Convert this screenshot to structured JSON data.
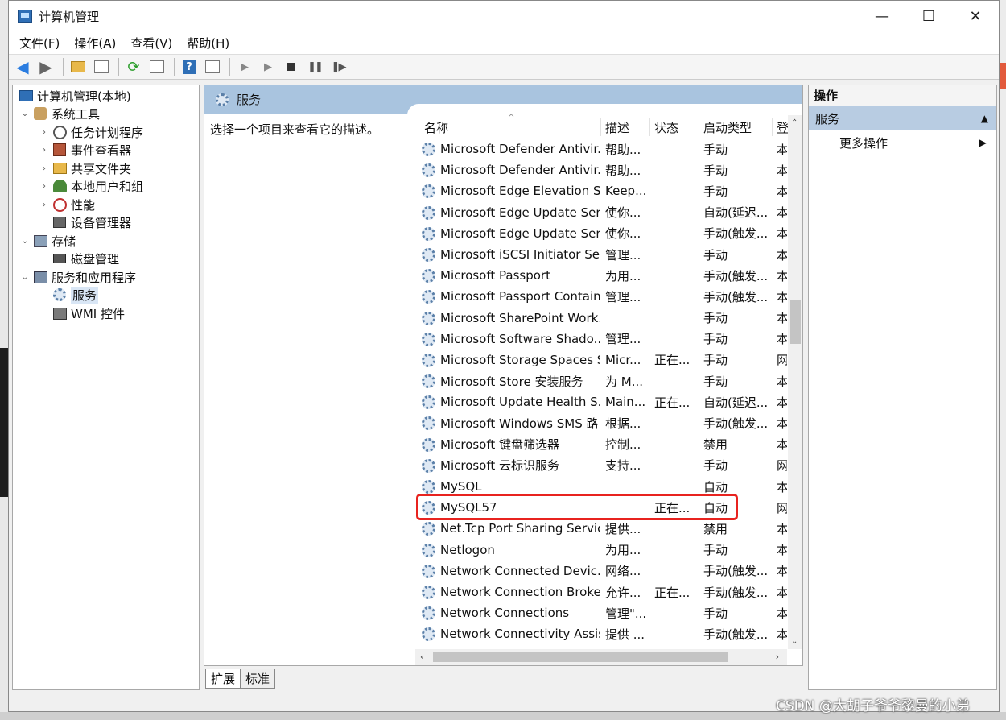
{
  "window": {
    "title": "计算机管理",
    "minimize": "—",
    "maximize": "☐",
    "close": "✕"
  },
  "menu": [
    "文件(F)",
    "操作(A)",
    "查看(V)",
    "帮助(H)"
  ],
  "tree": {
    "root": "计算机管理(本地)",
    "system_tools": "系统工具",
    "task_scheduler": "任务计划程序",
    "event_viewer": "事件查看器",
    "shared_folders": "共享文件夹",
    "local_users": "本地用户和组",
    "performance": "性能",
    "device_manager": "设备管理器",
    "storage": "存储",
    "disk_management": "磁盘管理",
    "services_apps": "服务和应用程序",
    "services": "服务",
    "wmi": "WMI 控件"
  },
  "middle": {
    "header": "服务",
    "description": "选择一个项目来查看它的描述。",
    "columns": {
      "name": "名称",
      "desc": "描述",
      "status": "状态",
      "start": "启动类型",
      "logon": "登"
    },
    "rows": [
      {
        "name": "Microsoft Defender Antivir...",
        "desc": "帮助...",
        "status": "",
        "start": "手动",
        "logon": "本"
      },
      {
        "name": "Microsoft Defender Antivir...",
        "desc": "帮助...",
        "status": "",
        "start": "手动",
        "logon": "本"
      },
      {
        "name": "Microsoft Edge Elevation S...",
        "desc": "Keep...",
        "status": "",
        "start": "手动",
        "logon": "本"
      },
      {
        "name": "Microsoft Edge Update Ser...",
        "desc": "使你...",
        "status": "",
        "start": "自动(延迟...",
        "logon": "本"
      },
      {
        "name": "Microsoft Edge Update Ser...",
        "desc": "使你...",
        "status": "",
        "start": "手动(触发...",
        "logon": "本"
      },
      {
        "name": "Microsoft iSCSI Initiator Ser...",
        "desc": "管理...",
        "status": "",
        "start": "手动",
        "logon": "本"
      },
      {
        "name": "Microsoft Passport",
        "desc": "为用...",
        "status": "",
        "start": "手动(触发...",
        "logon": "本"
      },
      {
        "name": "Microsoft Passport Container",
        "desc": "管理...",
        "status": "",
        "start": "手动(触发...",
        "logon": "本"
      },
      {
        "name": "Microsoft SharePoint Work...",
        "desc": "",
        "status": "",
        "start": "手动",
        "logon": "本"
      },
      {
        "name": "Microsoft Software Shado...",
        "desc": "管理...",
        "status": "",
        "start": "手动",
        "logon": "本"
      },
      {
        "name": "Microsoft Storage Spaces S...",
        "desc": "Micr...",
        "status": "正在...",
        "start": "手动",
        "logon": "网"
      },
      {
        "name": "Microsoft Store 安装服务",
        "desc": "为 M...",
        "status": "",
        "start": "手动",
        "logon": "本"
      },
      {
        "name": "Microsoft Update Health S...",
        "desc": "Main...",
        "status": "正在...",
        "start": "自动(延迟...",
        "logon": "本"
      },
      {
        "name": "Microsoft Windows SMS 路...",
        "desc": "根据...",
        "status": "",
        "start": "手动(触发...",
        "logon": "本"
      },
      {
        "name": "Microsoft 键盘筛选器",
        "desc": "控制...",
        "status": "",
        "start": "禁用",
        "logon": "本"
      },
      {
        "name": "Microsoft 云标识服务",
        "desc": "支持...",
        "status": "",
        "start": "手动",
        "logon": "网"
      },
      {
        "name": "MySQL",
        "desc": "",
        "status": "",
        "start": "自动",
        "logon": "本"
      },
      {
        "name": "MySQL57",
        "desc": "",
        "status": "正在...",
        "start": "自动",
        "logon": "网"
      },
      {
        "name": "Net.Tcp Port Sharing Service",
        "desc": "提供...",
        "status": "",
        "start": "禁用",
        "logon": "本"
      },
      {
        "name": "Netlogon",
        "desc": "为用...",
        "status": "",
        "start": "手动",
        "logon": "本"
      },
      {
        "name": "Network Connected Devic...",
        "desc": "网络...",
        "status": "",
        "start": "手动(触发...",
        "logon": "本"
      },
      {
        "name": "Network Connection Broker",
        "desc": "允许...",
        "status": "正在...",
        "start": "手动(触发...",
        "logon": "本"
      },
      {
        "name": "Network Connections",
        "desc": "管理\"...",
        "status": "",
        "start": "手动",
        "logon": "本"
      },
      {
        "name": "Network Connectivity Assis...",
        "desc": "提供 ...",
        "status": "",
        "start": "手动(触发...",
        "logon": "本"
      }
    ]
  },
  "tabs": [
    "扩展",
    "标准"
  ],
  "actions": {
    "header": "操作",
    "section": "服务",
    "more": "更多操作"
  },
  "watermark": "CSDN @大胡子爷爷黎曼的小弟"
}
